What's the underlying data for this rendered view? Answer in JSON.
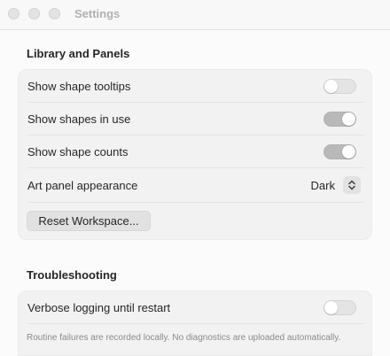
{
  "window": {
    "title": "Settings"
  },
  "library_panels": {
    "heading": "Library and Panels",
    "rows": [
      {
        "label": "Show shape tooltips",
        "control": "toggle",
        "value": "off"
      },
      {
        "label": "Show shapes in use",
        "control": "toggle",
        "value": "on"
      },
      {
        "label": "Show shape counts",
        "control": "toggle",
        "value": "on"
      },
      {
        "label": "Art panel appearance",
        "control": "popup",
        "value": "Dark"
      }
    ],
    "reset_button": "Reset Workspace..."
  },
  "troubleshooting": {
    "heading": "Troubleshooting",
    "rows": [
      {
        "label": "Verbose logging until restart",
        "control": "toggle",
        "value": "off"
      }
    ],
    "footnote": "Routine failures are recorded locally. No diagnostics are uploaded automatically."
  },
  "icons": {
    "stepper": "chevron-up-down-icon"
  },
  "colors": {
    "window_background": "#fbfbfb",
    "group_background": "#f2f2f2",
    "toggle_on": "#b9b9b9",
    "toggle_off": "#e4e4e4"
  }
}
